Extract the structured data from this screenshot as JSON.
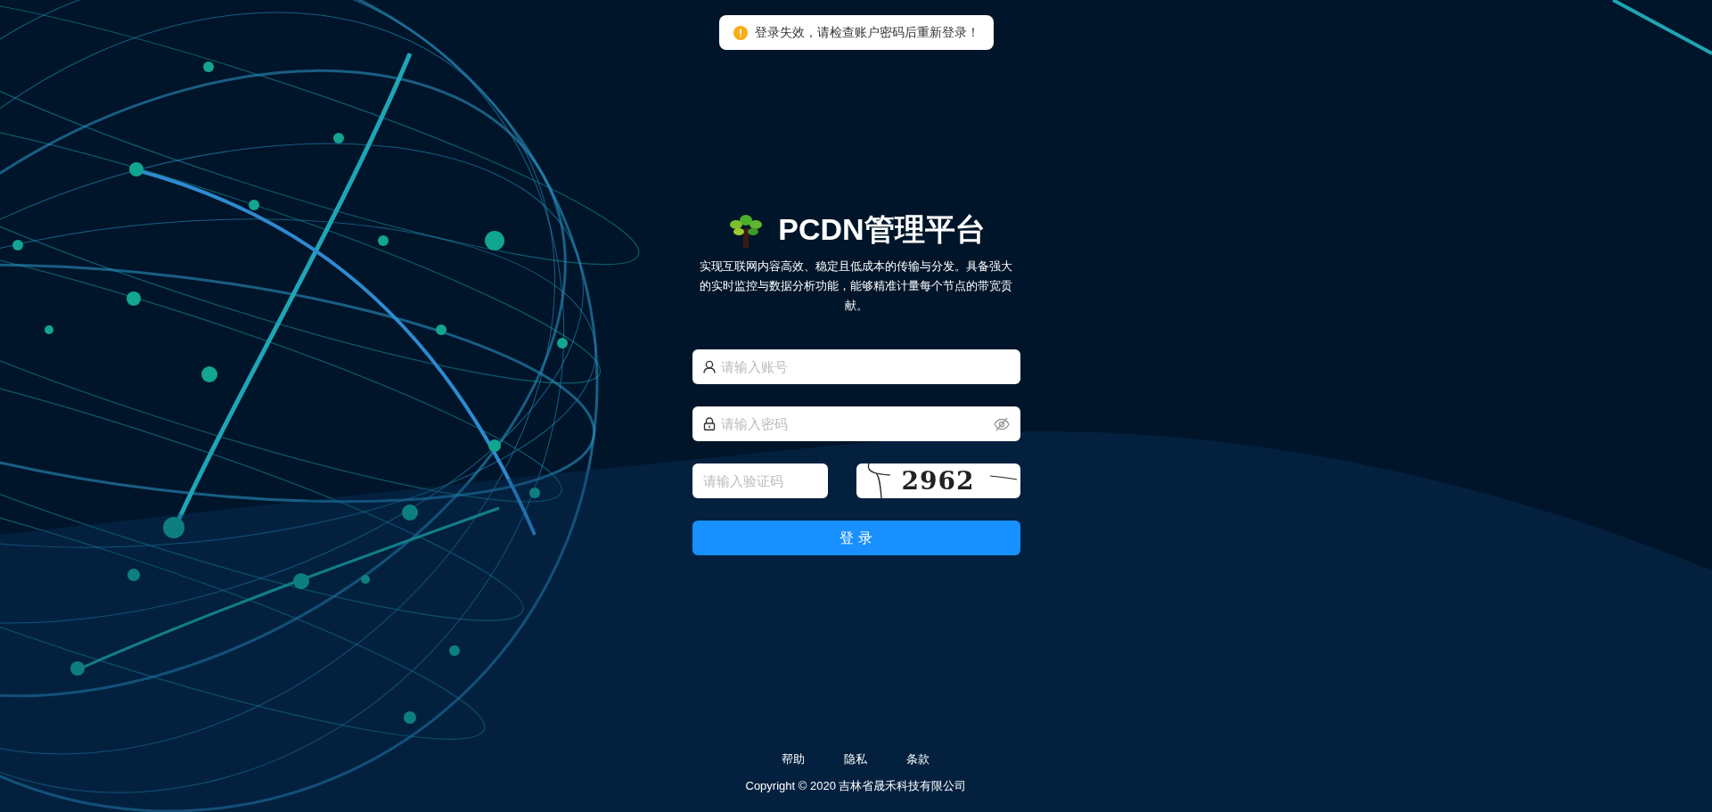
{
  "toast": {
    "kind": "warning",
    "message": "登录失效，请检查账户密码后重新登录！"
  },
  "brand": {
    "title": "PCDN管理平台",
    "description": "实现互联网内容高效、稳定且低成本的传输与分发。具备强大的实时监控与数据分析功能，能够精准计量每个节点的带宽贡献。"
  },
  "form": {
    "account": {
      "placeholder": "请输入账号"
    },
    "password": {
      "placeholder": "请输入密码",
      "visible": false
    },
    "captcha": {
      "placeholder": "请输入验证码",
      "image_text": "2962"
    },
    "submit": "登 录"
  },
  "footer": {
    "links": [
      "帮助",
      "隐私",
      "条款"
    ],
    "copyright": "Copyright © 2020 吉林省晟禾科技有限公司"
  }
}
